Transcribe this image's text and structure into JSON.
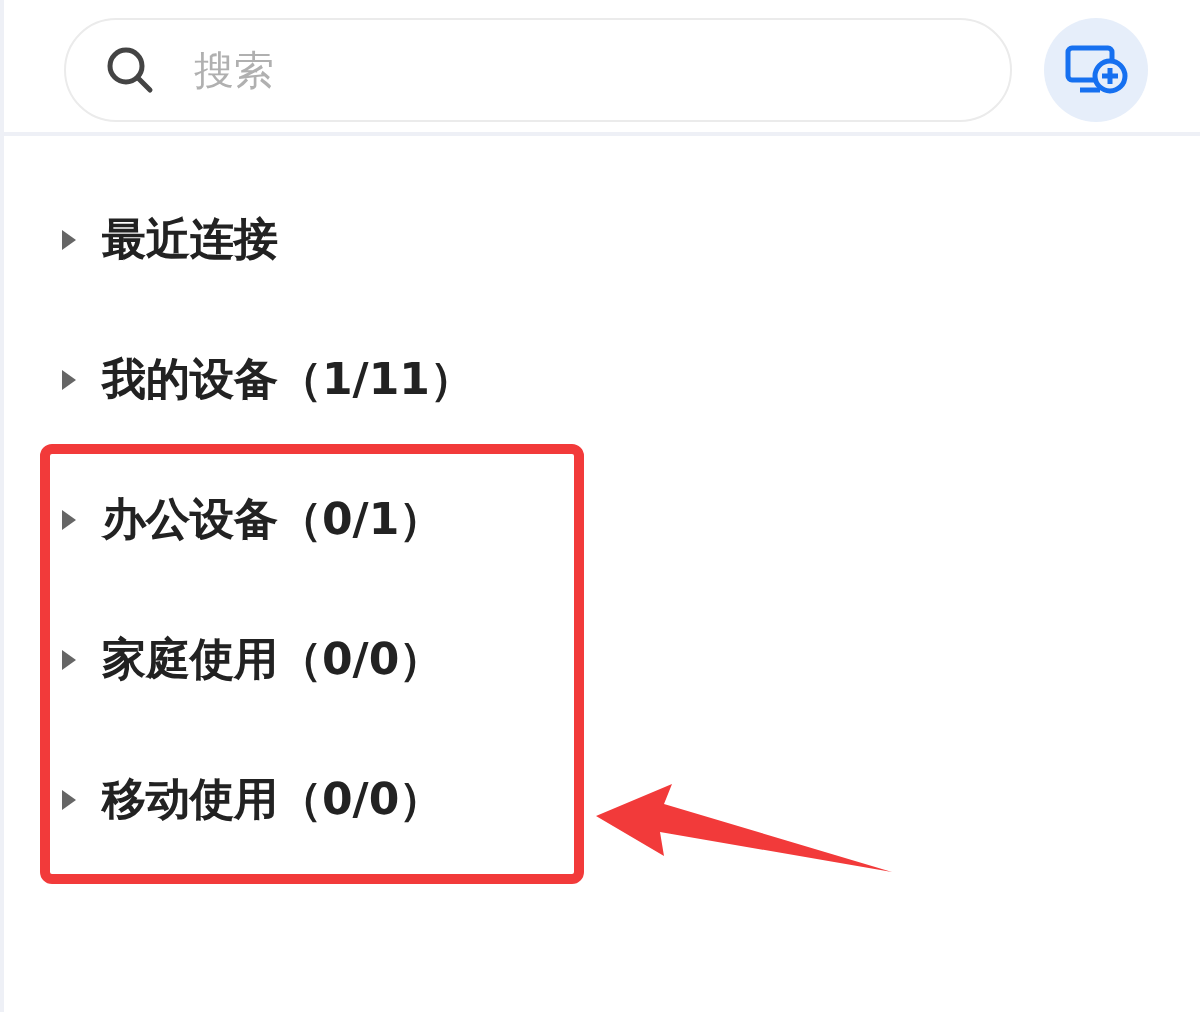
{
  "search": {
    "placeholder": "搜索"
  },
  "groups": [
    {
      "label": "最近连接",
      "expanded": false
    },
    {
      "label": "我的设备（1/11）",
      "expanded": false
    },
    {
      "label": "办公设备（0/1）",
      "expanded": false
    },
    {
      "label": "家庭使用（0/0）",
      "expanded": false
    },
    {
      "label": "移动使用（0/0）",
      "expanded": false
    }
  ]
}
